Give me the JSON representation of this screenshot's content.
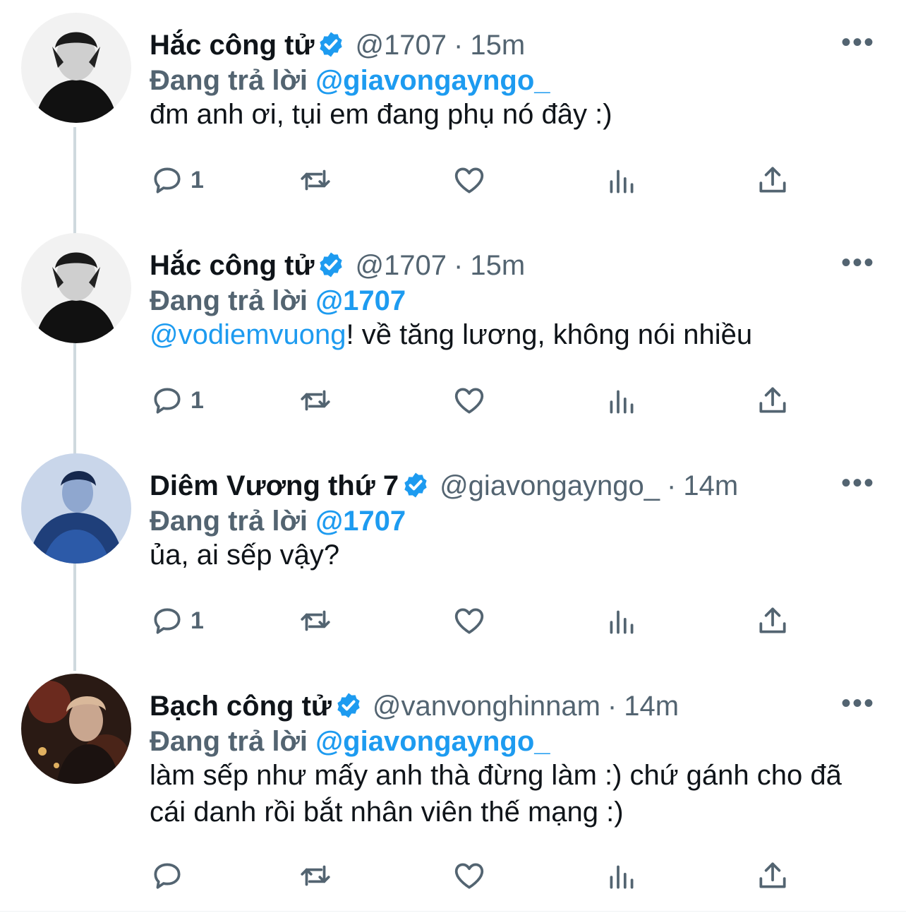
{
  "colors": {
    "link": "#1d9bf0",
    "muted": "#536471",
    "text": "#0f1419",
    "thread": "#cfd9de"
  },
  "reply_prefix": "Đang trả lời",
  "more_label": "•••",
  "tweets": [
    {
      "name": "Hắc công tử",
      "handle": "@1707",
      "sep": "·",
      "time": "15m",
      "reply_to": "@giavongayngo_",
      "mention": "",
      "text": "đm anh ơi, tụi em đang phụ nó đây :)",
      "reply_count": "1",
      "avatar": "bw-portrait"
    },
    {
      "name": "Hắc công tử",
      "handle": "@1707",
      "sep": "·",
      "time": "15m",
      "reply_to": "@1707",
      "mention": "@vodiemvuong",
      "text": "! về tăng lương, không nói nhiều",
      "reply_count": "1",
      "avatar": "bw-portrait"
    },
    {
      "name": "Diêm Vương thứ 7",
      "handle": "@giavongayngo_",
      "sep": "·",
      "time": "14m",
      "reply_to": "@1707",
      "mention": "",
      "text": "ủa, ai sếp vậy?",
      "reply_count": "1",
      "avatar": "blue-portrait"
    },
    {
      "name": "Bạch công tử",
      "handle": "@vanvonghinnam",
      "sep": "·",
      "time": "14m",
      "reply_to": "@giavongayngo_",
      "mention": "",
      "text": "làm sếp như mấy anh thà đừng làm :) chứ gánh cho đã cái danh rồi bắt nhân viên thế mạng :)",
      "reply_count": "",
      "avatar": "red-portrait"
    }
  ]
}
